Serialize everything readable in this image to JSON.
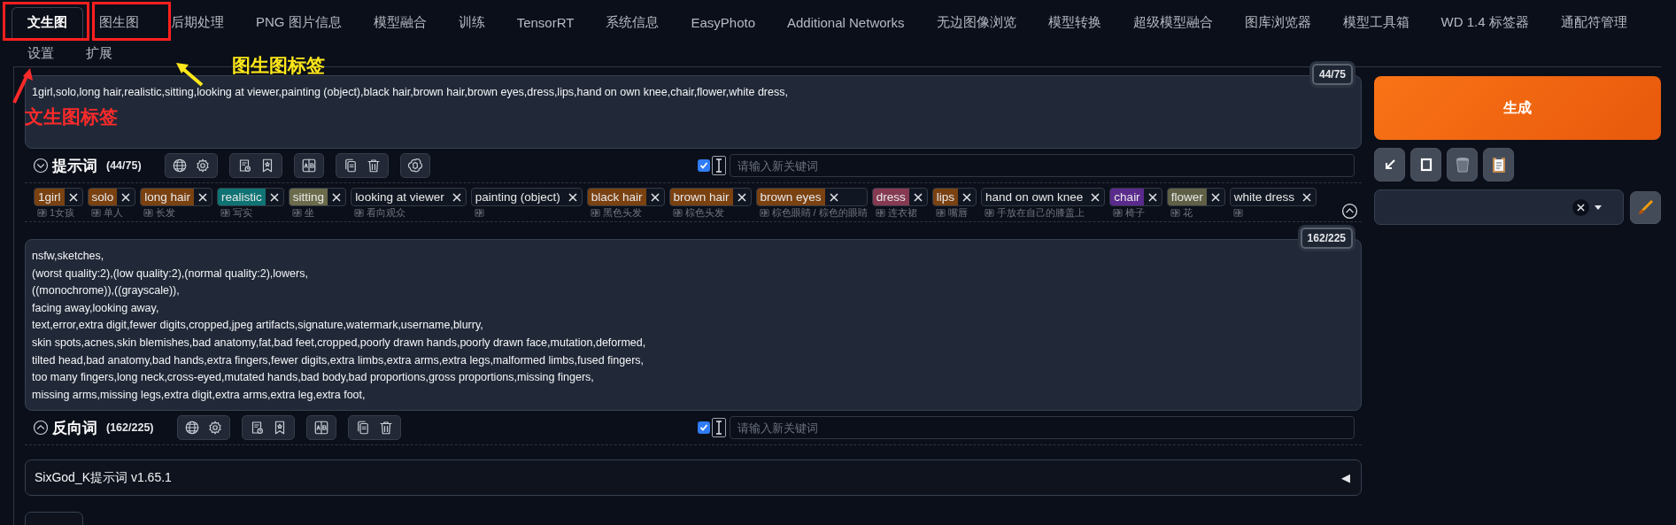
{
  "tabs": [
    {
      "label": "文生图",
      "selected": true
    },
    {
      "label": "图生图",
      "selected": false
    },
    {
      "label": "后期处理",
      "selected": false
    },
    {
      "label": "PNG 图片信息",
      "selected": false
    },
    {
      "label": "模型融合",
      "selected": false
    },
    {
      "label": "训练",
      "selected": false
    },
    {
      "label": "TensorRT",
      "selected": false
    },
    {
      "label": "系统信息",
      "selected": false
    },
    {
      "label": "EasyPhoto",
      "selected": false
    },
    {
      "label": "Additional Networks",
      "selected": false
    },
    {
      "label": "无边图像浏览",
      "selected": false
    },
    {
      "label": "模型转换",
      "selected": false
    },
    {
      "label": "超级模型融合",
      "selected": false
    },
    {
      "label": "图库浏览器",
      "selected": false
    },
    {
      "label": "模型工具箱",
      "selected": false
    },
    {
      "label": "WD 1.4 标签器",
      "selected": false
    },
    {
      "label": "通配符管理",
      "selected": false
    },
    {
      "label": "设置",
      "selected": false
    },
    {
      "label": "扩展",
      "selected": false
    }
  ],
  "annotations": [
    {
      "text": "文生图标签",
      "color": "#ff2a2a"
    },
    {
      "text": "图生图标签",
      "color": "#ffe81a"
    }
  ],
  "prompts": [
    {
      "kind": "positive",
      "counter": "44/75",
      "text": "1girl,solo,long hair,realistic,sitting,looking at viewer,painting (object),black hair,brown hair,brown eyes,dress,lips,hand on own knee,chair,flower,white dress,",
      "label": "提示词",
      "count": "(44/75)",
      "expanded": true,
      "checked": true,
      "placeholder": "请输入新关键词",
      "tags": [
        {
          "text": "1girl",
          "translation": "1女孩",
          "color": "#7a4111"
        },
        {
          "text": "solo",
          "translation": "单人",
          "color": "#7a4111"
        },
        {
          "text": "long hair",
          "translation": "长发",
          "color": "#7a4111"
        },
        {
          "text": "realistic",
          "translation": "写实",
          "color": "#0f7373"
        },
        {
          "text": "sitting",
          "translation": "坐",
          "color": "#6b6b4b"
        },
        {
          "text": "looking at viewer",
          "translation": "看向观众"
        },
        {
          "text": "painting (object)"
        },
        {
          "text": "black hair",
          "translation": "黑色头发",
          "color": "#7a4111"
        },
        {
          "text": "brown hair",
          "translation": "棕色头发",
          "color": "#7a4111"
        },
        {
          "text": "brown eyes",
          "translation": "棕色眼睛 / 棕色的眼睛",
          "color": "#7a4111"
        },
        {
          "text": "dress",
          "translation": "连衣裙",
          "color": "#853a52"
        },
        {
          "text": "lips",
          "translation": "嘴唇",
          "color": "#7a4111"
        },
        {
          "text": "hand on own knee",
          "translation": "手放在自己的膝盖上"
        },
        {
          "text": "chair",
          "translation": "椅子",
          "color": "#5a2a8c"
        },
        {
          "text": "flower",
          "translation": "花",
          "color": "#5f6045"
        },
        {
          "text": "white dress"
        }
      ]
    },
    {
      "kind": "negative",
      "counter": "162/225",
      "text": "nsfw,sketches,\n(worst quality:2),(low quality:2),(normal quality:2),lowers,\n((monochrome)),((grayscale)),\nfacing away,looking away,\ntext,error,extra digit,fewer digits,cropped,jpeg artifacts,signature,watermark,username,blurry,\nskin spots,acnes,skin blemishes,bad anatomy,fat,bad feet,cropped,poorly drawn hands,poorly drawn face,mutation,deformed,\ntilted head,bad anatomy,bad hands,extra fingers,fewer digits,extra limbs,extra arms,extra legs,malformed limbs,fused fingers,\ntoo many fingers,long neck,cross-eyed,mutated hands,bad body,bad proportions,gross proportions,missing fingers,\nmissing arms,missing legs,extra digit,extra arms,extra leg,extra foot,",
      "label": "反向词",
      "count": "(162/225)",
      "expanded": false,
      "checked": true,
      "placeholder": "请输入新关键词"
    }
  ],
  "generate_button": "生成",
  "extension": {
    "title": "SixGod_K提示词 v1.65.1",
    "toggle": "◀"
  }
}
